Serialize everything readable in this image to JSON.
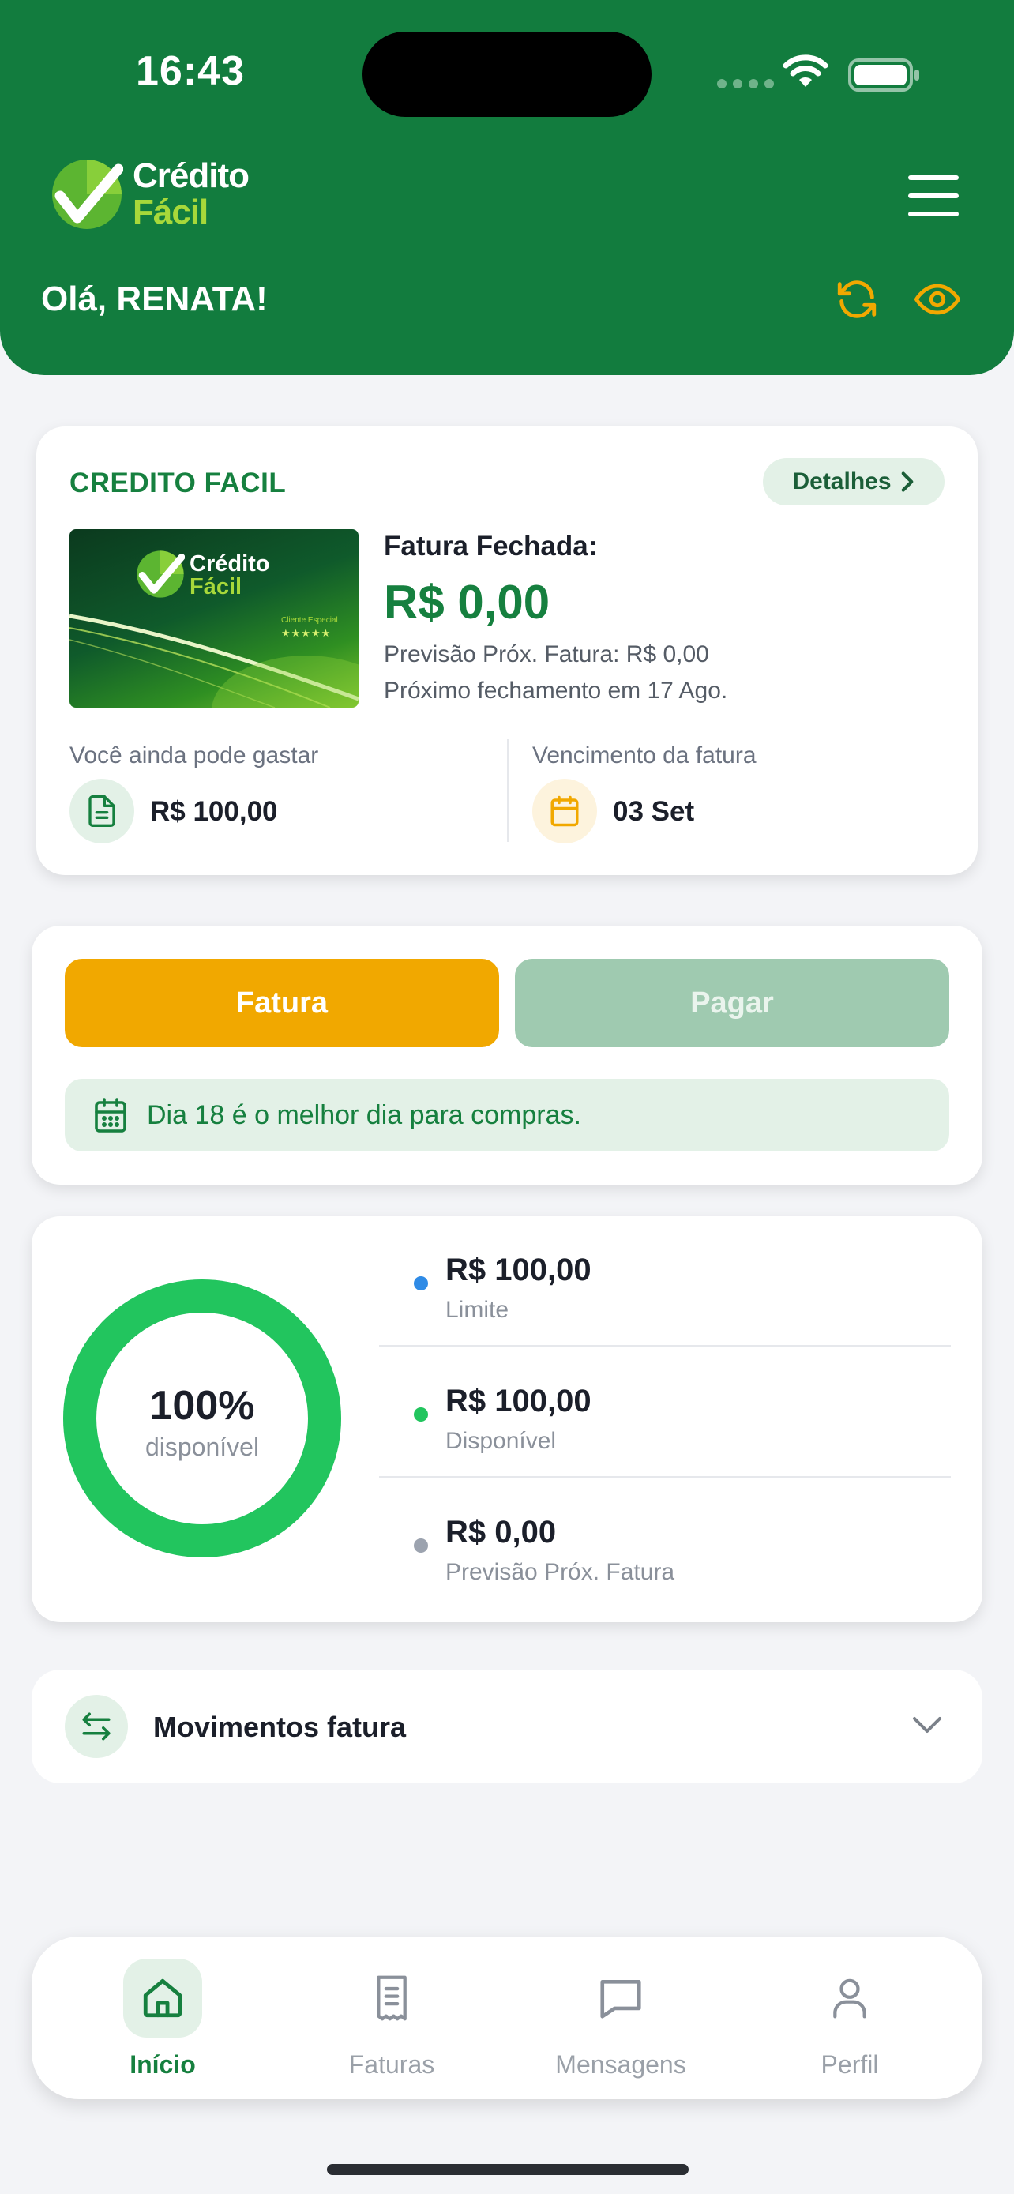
{
  "status_bar": {
    "time": "16:43"
  },
  "header": {
    "logo_line1": "Crédito",
    "logo_line2": "Fácil",
    "greeting": "Olá, RENATA!"
  },
  "account_card": {
    "title": "CREDITO FACIL",
    "details_label": "Detalhes",
    "card_logo_line1": "Crédito",
    "card_logo_line2": "Fácil",
    "card_tier": "Cliente Especial",
    "card_stars": "★★★★★",
    "invoice_label": "Fatura Fechada:",
    "invoice_amount": "R$ 0,00",
    "forecast": "Previsão Próx. Fatura: R$ 0,00",
    "next_closing": "Próximo fechamento em 17 Ago.",
    "spend_label": "Você ainda pode gastar",
    "spend_value": "R$ 100,00",
    "due_label": "Vencimento da fatura",
    "due_value": "03 Set"
  },
  "actions": {
    "invoice_button": "Fatura",
    "pay_button": "Pagar",
    "best_day_text": "Dia 18 é o melhor dia para compras."
  },
  "limits": {
    "available_percent": "100%",
    "available_percent_value": 100,
    "available_caption": "disponível",
    "items": [
      {
        "value": "R$ 100,00",
        "label": "Limite",
        "color": "#2f8be6"
      },
      {
        "value": "R$ 100,00",
        "label": "Disponível",
        "color": "#22c55e"
      },
      {
        "value": "R$ 0,00",
        "label": "Previsão Próx. Fatura",
        "color": "#9ca3af"
      }
    ]
  },
  "movements": {
    "label": "Movimentos fatura"
  },
  "bottom_nav": {
    "items": [
      {
        "label": "Início",
        "icon": "home-icon",
        "active": true
      },
      {
        "label": "Faturas",
        "icon": "receipt-icon",
        "active": false
      },
      {
        "label": "Mensagens",
        "icon": "message-icon",
        "active": false
      },
      {
        "label": "Perfil",
        "icon": "user-icon",
        "active": false
      }
    ]
  },
  "colors": {
    "brand_green": "#127c3e",
    "accent_green": "#16803f",
    "accent_yellow": "#f1a800",
    "logo_lime": "#a7d83a"
  }
}
